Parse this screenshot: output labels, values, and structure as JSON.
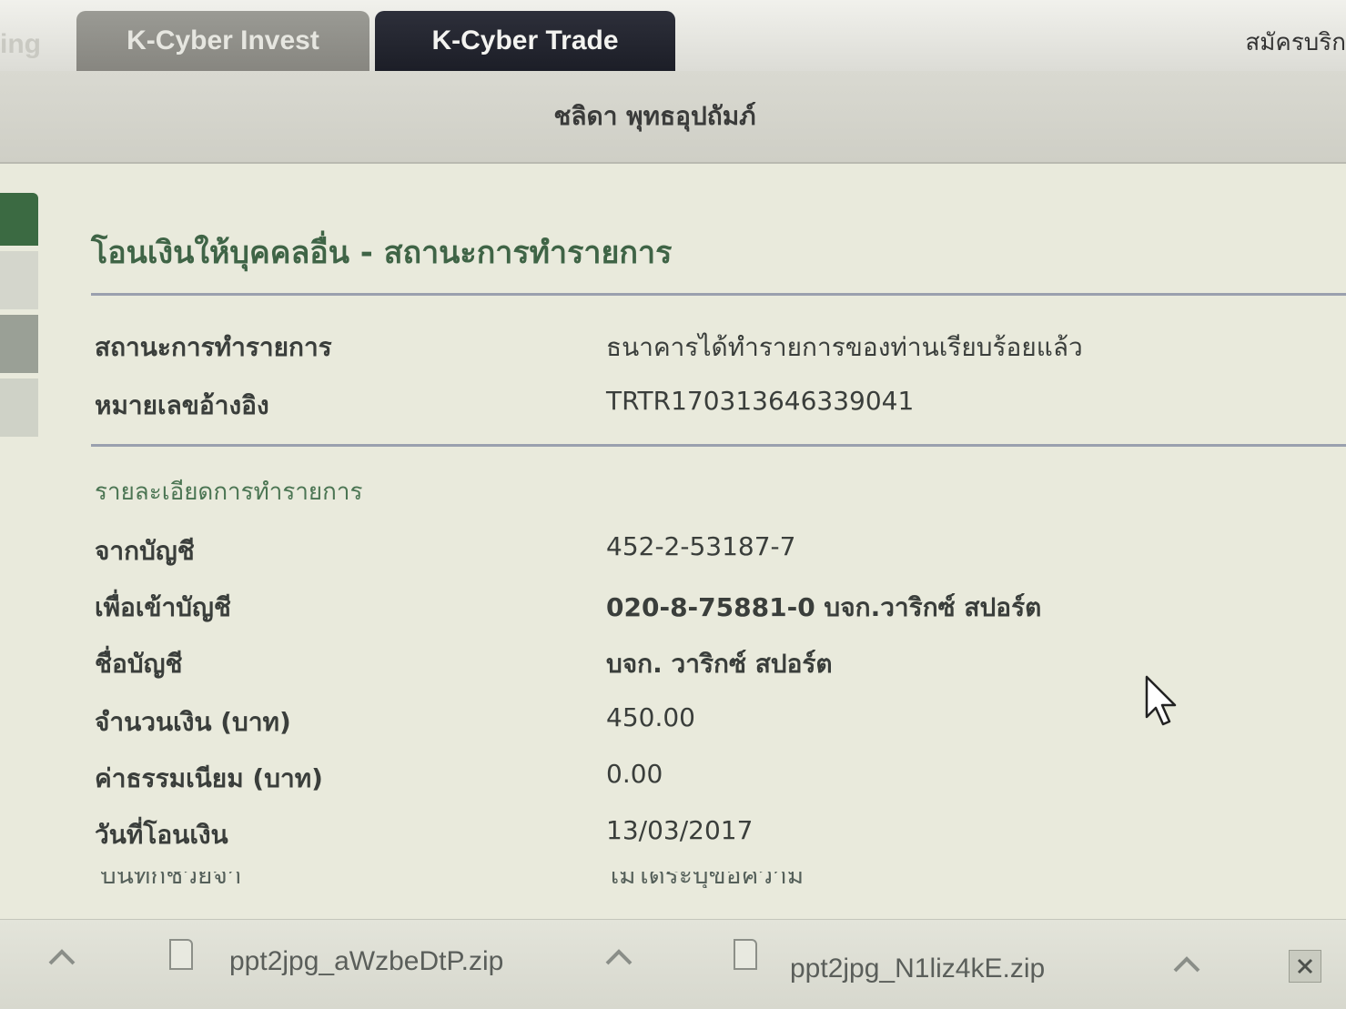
{
  "nav": {
    "partial_left_tab": "ing",
    "tabs": [
      {
        "label": "K-Cyber Invest"
      },
      {
        "label": "K-Cyber Trade"
      }
    ],
    "signup_link": "สมัครบริก"
  },
  "user": {
    "name": "ชลิดา พุทธอุปถัมภ์"
  },
  "page": {
    "title": "โอนเงินให้บุคคลอื่น - สถานะการทำรายการ"
  },
  "status": {
    "label": "สถานะการทำรายการ",
    "value": "ธนาคารได้ทำรายการของท่านเรียบร้อยแล้ว"
  },
  "reference": {
    "label": "หมายเลขอ้างอิง",
    "value": "TRTR170313646339041"
  },
  "details": {
    "section_title": "รายละเอียดการทำรายการ",
    "from_account": {
      "label": "จากบัญชี",
      "value": "452-2-53187-7"
    },
    "to_account": {
      "label": "เพื่อเข้าบัญชี",
      "value": "020-8-75881-0 บจก.วาริกซ์ สปอร์ต"
    },
    "account_name": {
      "label": "ชื่อบัญชี",
      "value": "บจก. วาริกซ์ สปอร์ต"
    },
    "amount": {
      "label": "จำนวนเงิน (บาท)",
      "value": "450.00"
    },
    "fee": {
      "label": "ค่าธรรมเนียม (บาท)",
      "value": "0.00"
    },
    "transfer_date": {
      "label": "วันที่โอนเงิน",
      "value": "13/03/2017"
    },
    "next_row_cutoff": {
      "label": "บันทึกช่วยจำ",
      "value": "ไม่ได้ระบุข้อความ"
    }
  },
  "downloads": [
    {
      "file": "ppt2jpg_aWzbeDtP.zip"
    },
    {
      "file": "ppt2jpg_N1liz4kE.zip"
    }
  ],
  "icons": {
    "chevron": "chevron-up-icon",
    "file": "file-icon",
    "close": "close-icon",
    "cursor": "mouse-pointer-icon"
  },
  "colors": {
    "accent_green": "#3f6446",
    "tab_active": "#1c1e27",
    "tab_inactive": "#878680"
  }
}
